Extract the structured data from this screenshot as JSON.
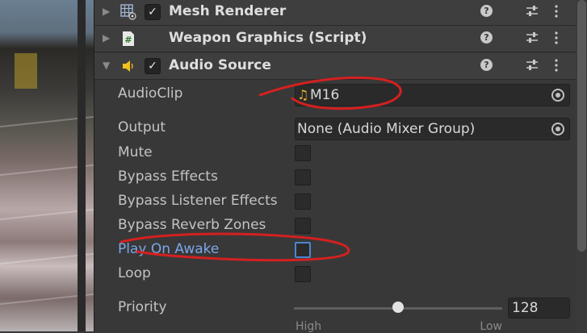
{
  "components": [
    {
      "title": "Mesh Renderer",
      "icon": "mesh-renderer-icon",
      "enabled": true
    },
    {
      "title": "Weapon Graphics (Script)",
      "icon": "csharp-script-icon",
      "enabled": null
    },
    {
      "title": "Audio Source",
      "icon": "audio-source-icon",
      "enabled": true
    }
  ],
  "header_glyphs": {
    "help": "?",
    "fold_collapsed": "▶",
    "fold_expanded": "▼",
    "check": "✓"
  },
  "audio_source": {
    "audioclip": {
      "label": "AudioClip",
      "value": "M16",
      "icon": "music-note-icon"
    },
    "output": {
      "label": "Output",
      "value": "None (Audio Mixer Group)"
    },
    "mute": {
      "label": "Mute",
      "checked": false
    },
    "bypass_effects": {
      "label": "Bypass Effects",
      "checked": false
    },
    "bypass_listener_effects": {
      "label": "Bypass Listener Effects",
      "checked": false
    },
    "bypass_reverb_zones": {
      "label": "Bypass Reverb Zones",
      "checked": false
    },
    "play_on_awake": {
      "label": "Play On Awake",
      "checked": false
    },
    "loop": {
      "label": "Loop",
      "checked": false
    },
    "priority": {
      "label": "Priority",
      "value": "128",
      "min_label": "High",
      "max_label": "Low",
      "level": 0.5
    }
  },
  "colors": {
    "annotation": "#d42020",
    "highlight_label": "#7ba6e8",
    "panel": "#383838"
  }
}
